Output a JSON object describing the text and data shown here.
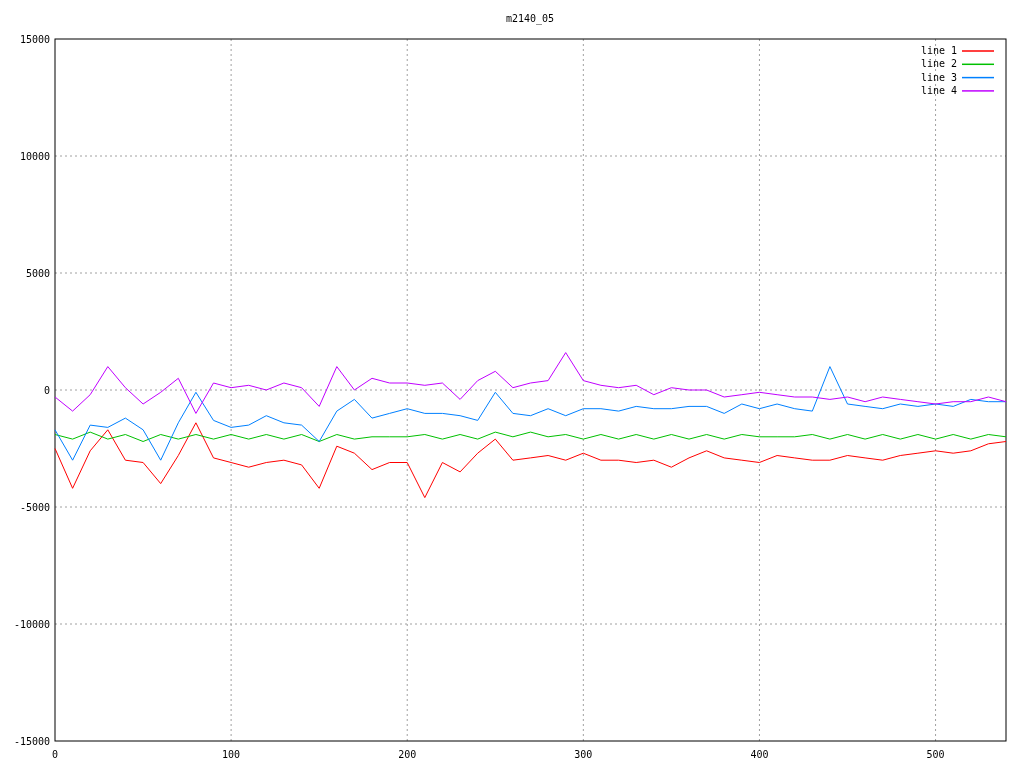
{
  "chart": {
    "chart_data": {
      "type": "line",
      "title": "m2140_05",
      "x": [
        0,
        10,
        20,
        30,
        40,
        50,
        60,
        70,
        80,
        90,
        100,
        110,
        120,
        130,
        140,
        150,
        160,
        170,
        180,
        190,
        200,
        210,
        220,
        230,
        240,
        250,
        260,
        270,
        280,
        290,
        300,
        310,
        320,
        330,
        340,
        350,
        360,
        370,
        380,
        390,
        400,
        410,
        420,
        430,
        440,
        450,
        460,
        470,
        480,
        490,
        500,
        510,
        520,
        530,
        540
      ],
      "series": [
        {
          "name": "line 1",
          "color": "#ff0000",
          "values": [
            -2500,
            -4200,
            -2600,
            -1700,
            -3000,
            -3100,
            -4000,
            -2800,
            -1400,
            -2900,
            -3100,
            -3300,
            -3100,
            -3000,
            -3200,
            -4200,
            -2400,
            -2700,
            -3400,
            -3100,
            -3100,
            -4600,
            -3100,
            -3500,
            -2700,
            -2100,
            -3000,
            -2900,
            -2800,
            -3000,
            -2700,
            -3000,
            -3000,
            -3100,
            -3000,
            -3300,
            -2900,
            -2600,
            -2900,
            -3000,
            -3100,
            -2800,
            -2900,
            -3000,
            -3000,
            -2800,
            -2900,
            -3000,
            -2800,
            -2700,
            -2600,
            -2700,
            -2600,
            -2300,
            -2200
          ]
        },
        {
          "name": "line 2",
          "color": "#00c000",
          "values": [
            -1900,
            -2100,
            -1800,
            -2100,
            -1900,
            -2200,
            -1900,
            -2100,
            -1900,
            -2100,
            -1900,
            -2100,
            -1900,
            -2100,
            -1900,
            -2200,
            -1900,
            -2100,
            -2000,
            -2000,
            -2000,
            -1900,
            -2100,
            -1900,
            -2100,
            -1800,
            -2000,
            -1800,
            -2000,
            -1900,
            -2100,
            -1900,
            -2100,
            -1900,
            -2100,
            -1900,
            -2100,
            -1900,
            -2100,
            -1900,
            -2000,
            -2000,
            -2000,
            -1900,
            -2100,
            -1900,
            -2100,
            -1900,
            -2100,
            -1900,
            -2100,
            -1900,
            -2100,
            -1900,
            -2000
          ]
        },
        {
          "name": "line 3",
          "color": "#0080ff",
          "values": [
            -1700,
            -3000,
            -1500,
            -1600,
            -1200,
            -1700,
            -3000,
            -1400,
            -100,
            -1300,
            -1600,
            -1500,
            -1100,
            -1400,
            -1500,
            -2200,
            -900,
            -400,
            -1200,
            -1000,
            -800,
            -1000,
            -1000,
            -1100,
            -1300,
            -100,
            -1000,
            -1100,
            -800,
            -1100,
            -800,
            -800,
            -900,
            -700,
            -800,
            -800,
            -700,
            -700,
            -1000,
            -600,
            -800,
            -600,
            -800,
            -900,
            1000,
            -600,
            -700,
            -800,
            -600,
            -700,
            -600,
            -700,
            -400,
            -500,
            -500
          ]
        },
        {
          "name": "line 4",
          "color": "#c000ff",
          "values": [
            -300,
            -900,
            -200,
            1000,
            100,
            -600,
            -100,
            500,
            -1000,
            300,
            100,
            200,
            0,
            300,
            100,
            -700,
            1000,
            0,
            500,
            300,
            300,
            200,
            300,
            -400,
            400,
            800,
            100,
            300,
            400,
            1600,
            400,
            200,
            100,
            200,
            -200,
            100,
            0,
            0,
            -300,
            -200,
            -100,
            -200,
            -300,
            -300,
            -400,
            -300,
            -500,
            -300,
            -400,
            -500,
            -600,
            -500,
            -500,
            -300,
            -500
          ]
        }
      ],
      "grid": true,
      "legend": true,
      "xlim": [
        0,
        540
      ],
      "ylim": [
        -15000,
        15000
      ],
      "xticks": [
        0,
        100,
        200,
        300,
        400,
        500
      ],
      "yticks": [
        -15000,
        -10000,
        -5000,
        0,
        5000,
        10000,
        15000
      ]
    }
  }
}
